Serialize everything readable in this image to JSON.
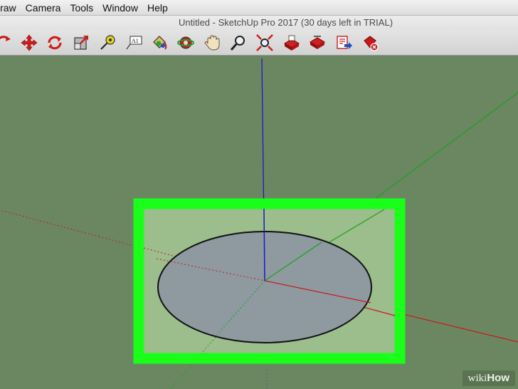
{
  "menu": {
    "items": [
      {
        "label": "Draw",
        "name": "menu-draw"
      },
      {
        "label": "Camera",
        "name": "menu-camera"
      },
      {
        "label": "Tools",
        "name": "menu-tools"
      },
      {
        "label": "Window",
        "name": "menu-window"
      },
      {
        "label": "Help",
        "name": "menu-help"
      }
    ]
  },
  "window": {
    "title": "Untitled - SketchUp Pro 2017 (30 days left in TRIAL)"
  },
  "toolbar": {
    "tools": [
      "rotate-arc-icon",
      "move-icon",
      "rotate-icon",
      "scale-icon",
      "tape-measure-icon",
      "text-icon",
      "paint-bucket-icon",
      "orbit-icon",
      "pan-icon",
      "zoom-icon",
      "zoom-extents-icon",
      "warehouse-icon",
      "components-icon",
      "share-model-icon",
      "extension-warehouse-icon",
      "ruby-icon"
    ],
    "text_tool_label": "A1"
  },
  "colors": {
    "highlight": "#1aff1a",
    "axis_blue": "#1a1ac8",
    "axis_red": "#c81a1a",
    "axis_green": "#1aa01a",
    "circle_face": "#8e9aa0",
    "background": "#6b8762"
  },
  "watermark": {
    "prefix": "wiki",
    "suffix": "How"
  }
}
